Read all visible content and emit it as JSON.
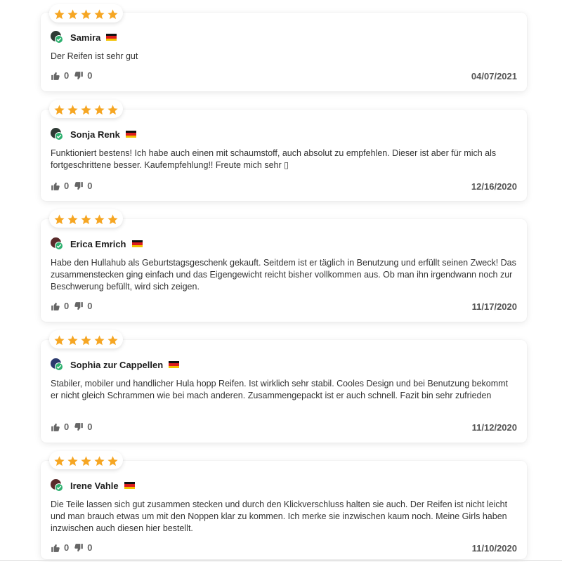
{
  "colors": {
    "star": "#f6a623",
    "verified": "#2fb170",
    "flag_black": "#111111",
    "flag_red": "#dd1d1d",
    "flag_gold": "#f2c200"
  },
  "icons": {
    "star": "star-icon",
    "like": "thumbs-up-icon",
    "dislike": "thumbs-down-icon",
    "verified": "verified-check-icon",
    "flag": "german-flag-icon"
  },
  "reviews": [
    {
      "rating": 5,
      "name": "Samira",
      "country_flag": "DE",
      "text": "Der Reifen ist sehr gut",
      "likes": "0",
      "dislikes": "0",
      "date": "04/07/2021"
    },
    {
      "rating": 5,
      "name": "Sonja Renk",
      "country_flag": "DE",
      "text": "Funktioniert bestens! Ich habe auch einen mit schaumstoff, auch absolut zu empfehlen. Dieser ist aber für mich als fortgeschrittene besser. Kaufempfehlung!! Freute mich sehr ▯",
      "likes": "0",
      "dislikes": "0",
      "date": "12/16/2020"
    },
    {
      "rating": 5,
      "name": "Erica Emrich",
      "country_flag": "DE",
      "text": "Habe den Hullahub als Geburtstagsgeschenk gekauft. Seitdem ist er täglich in Benutzung und erfüllt seinen Zweck! Das zusammenstecken ging einfach und das Eigengewicht reicht bisher vollkommen aus. Ob man ihn irgendwann noch zur Beschwerung befüllt, wird sich zeigen.",
      "likes": "0",
      "dislikes": "0",
      "date": "11/17/2020"
    },
    {
      "rating": 5,
      "name": "Sophia zur Cappellen",
      "country_flag": "DE",
      "text": "Stabiler, mobiler und handlicher Hula hopp Reifen. Ist wirklich sehr stabil. Cooles Design und bei Benutzung bekommt er nicht gleich Schrammen wie bei mach anderen. Zusammengepackt ist er auch schnell. Fazit bin sehr zufrieden",
      "likes": "0",
      "dislikes": "0",
      "date": "11/12/2020"
    },
    {
      "rating": 5,
      "name": "Irene Vahle",
      "country_flag": "DE",
      "text": "Die Teile lassen sich gut zusammen stecken und durch den Klickverschluss halten sie auch. Der Reifen ist nicht leicht und man brauch etwas um mit den Noppen klar zu kommen. Ich merke sie inzwischen kaum noch. Meine Girls haben inzwischen auch diesen hier bestellt.",
      "likes": "0",
      "dislikes": "0",
      "date": "11/10/2020"
    }
  ]
}
